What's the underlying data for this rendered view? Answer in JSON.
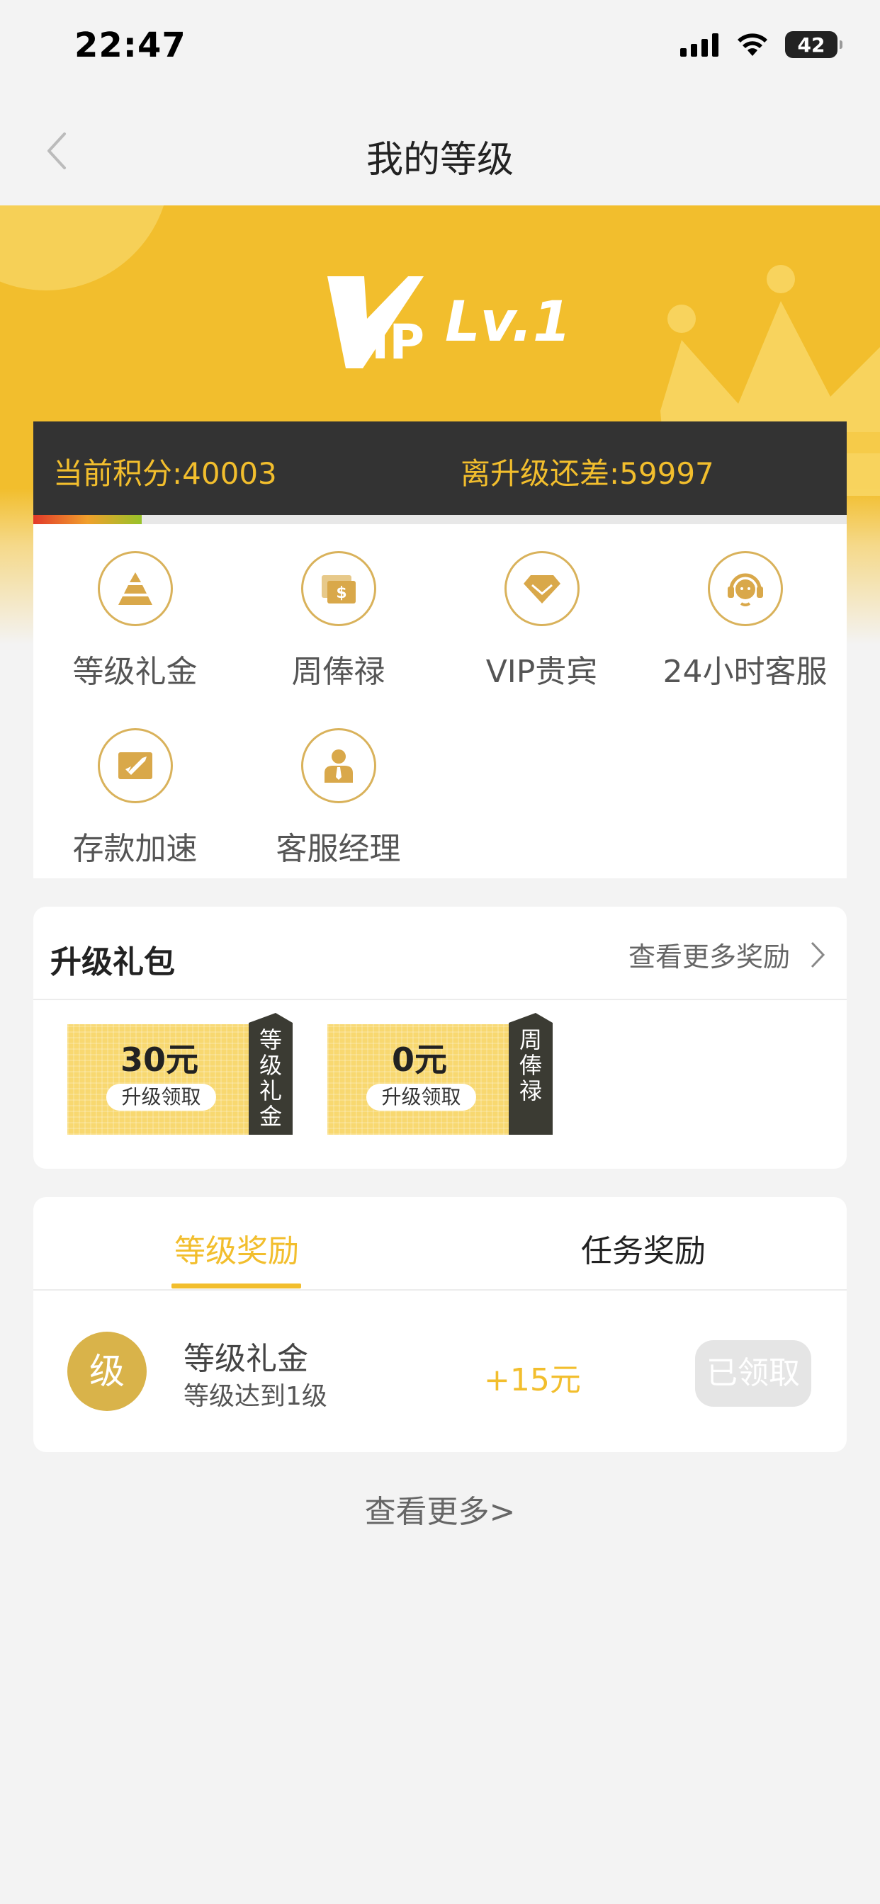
{
  "status_bar": {
    "time": "22:47",
    "battery": "42"
  },
  "nav": {
    "title": "我的等级"
  },
  "hero": {
    "vip_text": "VIP",
    "level": "Lv.1"
  },
  "points": {
    "current_label": "当前积分:40003",
    "remaining_label": "离升级还差:59997",
    "progress_fraction": 0.133
  },
  "benefits": [
    {
      "label": "等级礼金",
      "icon": "pyramid-icon"
    },
    {
      "label": "周俸禄",
      "icon": "money-bill-icon"
    },
    {
      "label": "VIP贵宾",
      "icon": "diamond-icon"
    },
    {
      "label": "24小时客服",
      "icon": "headset-icon"
    },
    {
      "label": "存款加速",
      "icon": "rocket-icon"
    },
    {
      "label": "客服经理",
      "icon": "manager-icon"
    }
  ],
  "package": {
    "title": "升级礼包",
    "more_label": "查看更多奖励",
    "vouchers": [
      {
        "amount": "30元",
        "button": "升级领取",
        "tag": "等级礼金"
      },
      {
        "amount": "0元",
        "button": "升级领取",
        "tag": "周俸禄"
      }
    ]
  },
  "rewards": {
    "tabs": [
      {
        "label": "等级奖励",
        "active": true
      },
      {
        "label": "任务奖励",
        "active": false
      }
    ],
    "items": [
      {
        "badge": "级",
        "title": "等级礼金",
        "subtitle": "等级达到1级",
        "amount": "+15元",
        "button": "已领取"
      }
    ]
  },
  "view_more": "查看更多>",
  "colors": {
    "accent": "#f2be2d",
    "dark": "#333333",
    "gold": "#d9b25b",
    "background": "#f3f3f3"
  }
}
